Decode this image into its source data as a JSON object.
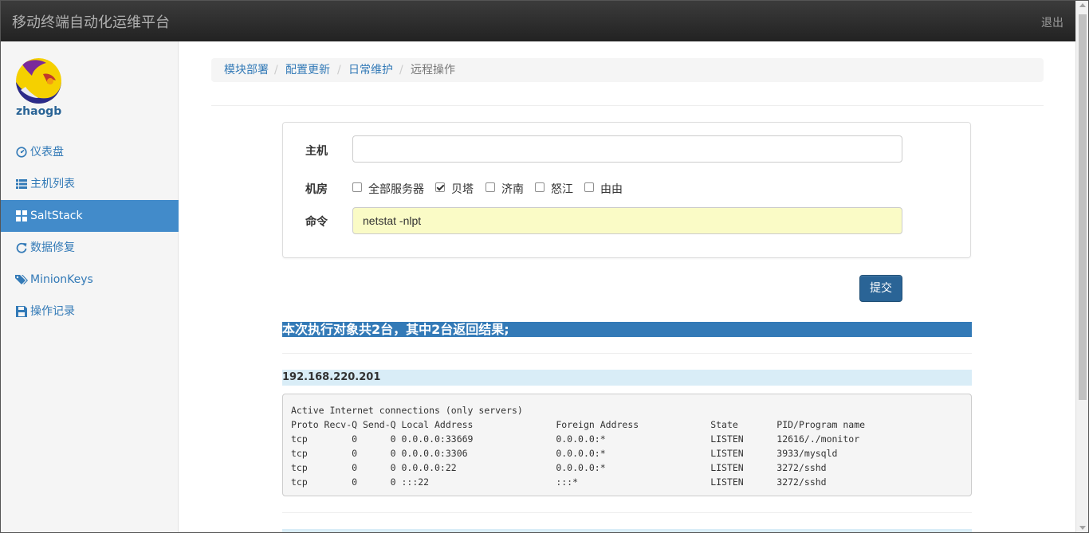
{
  "app": {
    "title": "移动终端自动化运维平台",
    "logout": "退出"
  },
  "user": {
    "name": "zhaogb"
  },
  "sidebar": {
    "items": [
      {
        "label": "仪表盘",
        "icon": "dashboard-icon"
      },
      {
        "label": "主机列表",
        "icon": "list-icon"
      },
      {
        "label": "SaltStack",
        "icon": "grid-icon",
        "active": true
      },
      {
        "label": "数据修复",
        "icon": "refresh-icon"
      },
      {
        "label": "MinionKeys",
        "icon": "tags-icon"
      },
      {
        "label": "操作记录",
        "icon": "save-icon"
      }
    ]
  },
  "breadcrumb": [
    "模块部署",
    "配置更新",
    "日常维护",
    "远程操作"
  ],
  "form": {
    "host_label": "主机",
    "host_value": "",
    "room_label": "机房",
    "rooms": [
      {
        "label": "全部服务器",
        "checked": false
      },
      {
        "label": "贝塔",
        "checked": true
      },
      {
        "label": "济南",
        "checked": false
      },
      {
        "label": "怒江",
        "checked": false
      },
      {
        "label": "由由",
        "checked": false
      }
    ],
    "cmd_label": "命令",
    "cmd_value": "netstat -nlpt",
    "submit_label": "提交"
  },
  "result": {
    "summary": "本次执行对象共2台，其中2台返回结果;",
    "hosts": [
      {
        "ip": "192.168.220.201",
        "output": "Active Internet connections (only servers)\nProto Recv-Q Send-Q Local Address               Foreign Address             State       PID/Program name\ntcp        0      0 0.0.0.0:33669               0.0.0.0:*                   LISTEN      12616/./monitor\ntcp        0      0 0.0.0.0:3306                0.0.0.0:*                   LISTEN      3933/mysqld\ntcp        0      0 0.0.0.0:22                  0.0.0.0:*                   LISTEN      3272/sshd\ntcp        0      0 :::22                       :::*                        LISTEN      3272/sshd"
      }
    ]
  },
  "colors": {
    "navbar": "#222222",
    "accent": "#428bca",
    "link": "#337ab7",
    "submit": "#2a6496",
    "cmd_bg": "#fafbc6"
  }
}
